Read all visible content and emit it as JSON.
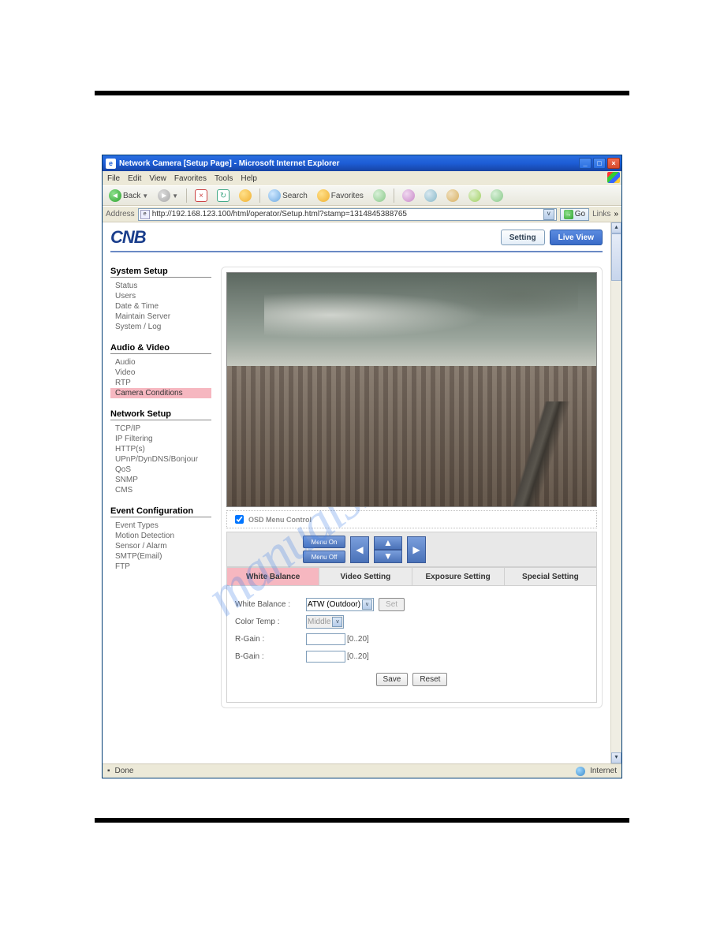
{
  "titlebar": {
    "title": "Network Camera [Setup Page] - Microsoft Internet Explorer"
  },
  "menubar": {
    "items": [
      "File",
      "Edit",
      "View",
      "Favorites",
      "Tools",
      "Help"
    ]
  },
  "toolbar": {
    "back": "Back",
    "search": "Search",
    "favorites": "Favorites"
  },
  "addressbar": {
    "label": "Address",
    "url": "http://192.168.123.100/html/operator/Setup.html?stamp=1314845388765",
    "go": "Go",
    "links": "Links"
  },
  "header": {
    "logo": "CNB",
    "setting": "Setting",
    "liveview": "Live View"
  },
  "sidebar": {
    "groups": [
      {
        "title": "System Setup",
        "items": [
          "Status",
          "Users",
          "Date & Time",
          "Maintain Server",
          "System / Log"
        ]
      },
      {
        "title": "Audio & Video",
        "items": [
          "Audio",
          "Video",
          "RTP",
          "Camera Conditions"
        ]
      },
      {
        "title": "Network Setup",
        "items": [
          "TCP/IP",
          "IP Filtering",
          "HTTP(s)",
          "UPnP/DynDNS/Bonjour",
          "QoS",
          "SNMP",
          "CMS"
        ]
      },
      {
        "title": "Event Configuration",
        "items": [
          "Event Types",
          "Motion Detection",
          "Sensor / Alarm",
          "SMTP(Email)",
          "FTP"
        ]
      }
    ],
    "active": "Camera Conditions"
  },
  "osd": {
    "label": "OSD Menu Control"
  },
  "controls": {
    "menuon": "Menu On",
    "menuoff": "Menu Off"
  },
  "tabs": {
    "items": [
      "White Balance",
      "Video Setting",
      "Exposure Setting",
      "Special Setting"
    ],
    "active": "White Balance"
  },
  "form": {
    "wb_label": "White Balance :",
    "wb_value": "ATW (Outdoor)",
    "set_btn": "Set",
    "ct_label": "Color Temp :",
    "ct_value": "Middle",
    "rg_label": "R-Gain :",
    "rg_value": "",
    "rg_hint": "[0..20]",
    "bg_label": "B-Gain :",
    "bg_value": "",
    "bg_hint": "[0..20]",
    "save": "Save",
    "reset": "Reset"
  },
  "statusbar": {
    "done": "Done",
    "zone": "Internet"
  },
  "watermark": "manualshive.com"
}
